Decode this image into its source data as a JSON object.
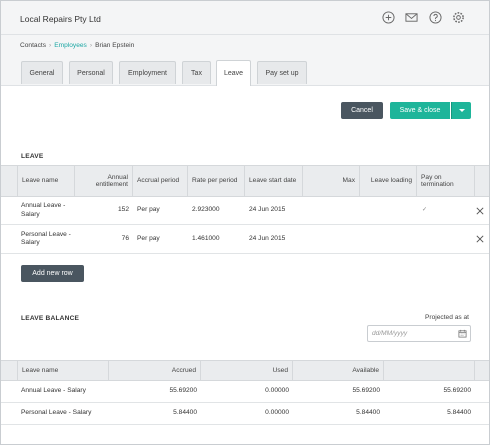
{
  "header": {
    "org_name": "Local Repairs Pty Ltd",
    "icons": [
      "plus-circle-icon",
      "mail-icon",
      "help-icon",
      "gear-icon"
    ]
  },
  "breadcrumb": {
    "contacts": "Contacts",
    "employees": "Employees",
    "employee": "Brian Epstein"
  },
  "tabs": [
    {
      "label": "General"
    },
    {
      "label": "Personal"
    },
    {
      "label": "Employment"
    },
    {
      "label": "Tax"
    },
    {
      "label": "Leave",
      "active": true
    },
    {
      "label": "Pay set up"
    }
  ],
  "actions": {
    "cancel_label": "Cancel",
    "save_label": "Save & close"
  },
  "leave": {
    "title": "LEAVE",
    "columns": {
      "name": "Leave name",
      "entitlement": "Annual entitlement",
      "accrual": "Accrual period",
      "rate": "Rate per period",
      "start": "Leave start date",
      "max": "Max",
      "loading": "Leave loading",
      "pay_on_termination": "Pay on termination"
    },
    "rows": [
      {
        "name": "Annual Leave - Salary",
        "entitlement": "152",
        "accrual": "Per pay",
        "rate": "2.923000",
        "start": "24 Jun 2015",
        "max": "",
        "loading": "",
        "pay_on_termination_checked": true
      },
      {
        "name": "Personal Leave - Salary",
        "entitlement": "76",
        "accrual": "Per pay",
        "rate": "1.461000",
        "start": "24 Jun 2015",
        "max": "",
        "loading": "",
        "pay_on_termination_checked": false
      }
    ],
    "add_row_label": "Add new row"
  },
  "balance": {
    "title": "LEAVE BALANCE",
    "projected_label": "Projected as at",
    "date_placeholder": "dd/MM/yyyy",
    "columns": {
      "name": "Leave name",
      "accrued": "Accrued",
      "used": "Used",
      "available": "Available",
      "projected": ""
    },
    "rows": [
      {
        "name": "Annual Leave - Salary",
        "accrued": "55.69200",
        "used": "0.00000",
        "available": "55.69200",
        "projected": "55.69200"
      },
      {
        "name": "Personal Leave - Salary",
        "accrued": "5.84400",
        "used": "0.00000",
        "available": "5.84400",
        "projected": "5.84400"
      }
    ]
  },
  "colors": {
    "accent": "#1ca7a4",
    "primary_button": "#1eb59a",
    "dark_button": "#4a5660"
  }
}
